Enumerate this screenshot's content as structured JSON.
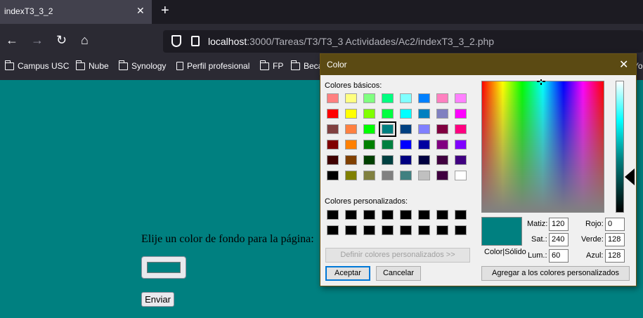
{
  "browser": {
    "tab_title": "indexT3_3_2",
    "tab_close": "✕",
    "new_tab": "+",
    "nav": {
      "back": "←",
      "forward": "→",
      "reload": "↻",
      "home": "⌂"
    },
    "url_host": "localhost",
    "url_rest": ":3000/Tareas/T3/T3_3 Actividades/Ac2/indexT3_3_2.php",
    "bookmarks": [
      "Campus USC",
      "Nube",
      "Synology",
      "Perfil profesional",
      "FP",
      "Beca",
      "Yo"
    ],
    "theme": {
      "chrome_dark": "#1c1b22",
      "chrome": "#2b2a33",
      "tab_active": "#42414d"
    }
  },
  "page": {
    "background_color": "#008080",
    "prompt": "Elije un color de fondo para la página:",
    "color_value": "#008080",
    "submit_label": "Enviar"
  },
  "dialog": {
    "title": "Color",
    "close": "✕",
    "basic_label": "Colores básicos:",
    "custom_label": "Colores personalizados:",
    "define_custom_label": "Definir colores personalizados >>",
    "accept_label": "Aceptar",
    "cancel_label": "Cancelar",
    "add_custom_label": "Agregar a los colores personalizados",
    "color_solid_label": "Color|Sólido",
    "fields": {
      "hue_label": "Matiz:",
      "hue": "120",
      "sat_label": "Sat.:",
      "sat": "240",
      "lum_label": "Lum.:",
      "lum": "60",
      "red_label": "Rojo:",
      "red": "0",
      "green_label": "Verde:",
      "green": "128",
      "blue_label": "Azul:",
      "blue": "128"
    },
    "title_bar_color": "#5b4a13",
    "basic_colors": [
      [
        "#ff8080",
        "#ffff80",
        "#80ff80",
        "#00ff80",
        "#80ffff",
        "#0080ff",
        "#ff80c0",
        "#ff80ff"
      ],
      [
        "#ff0000",
        "#ffff00",
        "#80ff00",
        "#00ff40",
        "#00ffff",
        "#0080c0",
        "#8080c0",
        "#ff00ff"
      ],
      [
        "#804040",
        "#ff8040",
        "#00ff00",
        "#008080",
        "#004080",
        "#8080ff",
        "#800040",
        "#ff0080"
      ],
      [
        "#800000",
        "#ff8000",
        "#008000",
        "#008040",
        "#0000ff",
        "#0000a0",
        "#800080",
        "#8000ff"
      ],
      [
        "#400000",
        "#804000",
        "#004000",
        "#004040",
        "#000080",
        "#000040",
        "#400040",
        "#400080"
      ],
      [
        "#000000",
        "#808000",
        "#808040",
        "#808080",
        "#408080",
        "#c0c0c0",
        "#400040",
        "#ffffff"
      ]
    ],
    "selected_basic": [
      2,
      3
    ]
  }
}
